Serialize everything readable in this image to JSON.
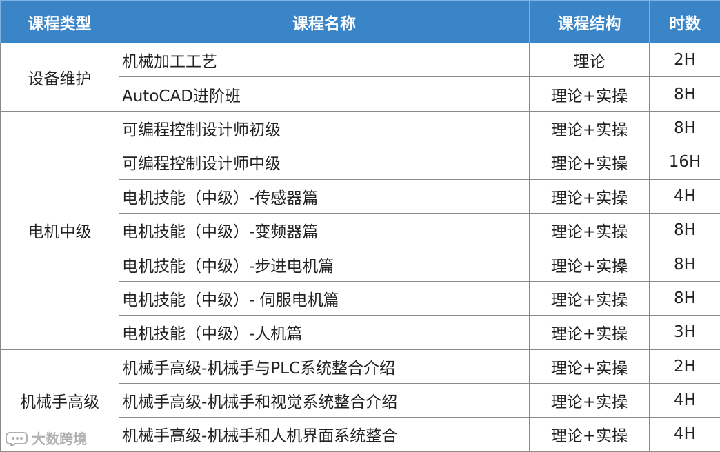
{
  "header": {
    "type": "课程类型",
    "name": "课程名称",
    "structure": "课程结构",
    "hours": "时数"
  },
  "groups": [
    {
      "type": "设备维护",
      "rows": [
        {
          "name": "机械加工工艺",
          "structure": "理论",
          "hours": "2H"
        },
        {
          "name": "AutoCAD进阶班",
          "structure": "理论+实操",
          "hours": "8H"
        }
      ]
    },
    {
      "type": "电机中级",
      "rows": [
        {
          "name": "可编程控制设计师初级",
          "structure": "理论+实操",
          "hours": "8H"
        },
        {
          "name": "可编程控制设计师中级",
          "structure": "理论+实操",
          "hours": "16H"
        },
        {
          "name": "电机技能（中级）-传感器篇",
          "structure": "理论+实操",
          "hours": "4H"
        },
        {
          "name": "电机技能（中级）-变频器篇",
          "structure": "理论+实操",
          "hours": "8H"
        },
        {
          "name": "电机技能（中级）-步进电机篇",
          "structure": "理论+实操",
          "hours": "8H"
        },
        {
          "name": "电机技能（中级）- 伺服电机篇",
          "structure": "理论+实操",
          "hours": "8H"
        },
        {
          "name": "电机技能（中级）-人机篇",
          "structure": "理论+实操",
          "hours": "3H"
        }
      ]
    },
    {
      "type": "机械手高级",
      "rows": [
        {
          "name": "机械手高级-机械手与PLC系统整合介绍",
          "structure": "理论+实操",
          "hours": "2H"
        },
        {
          "name": "机械手高级-机械手和视觉系统整合介绍",
          "structure": "理论+实操",
          "hours": "4H"
        },
        {
          "name": "机械手高级-机械手和人机界面系统整合",
          "structure": "理论+实操",
          "hours": "4H"
        }
      ]
    }
  ],
  "watermark": {
    "text": "大数跨境",
    "icon": "chat-bubble-logo-icon"
  }
}
